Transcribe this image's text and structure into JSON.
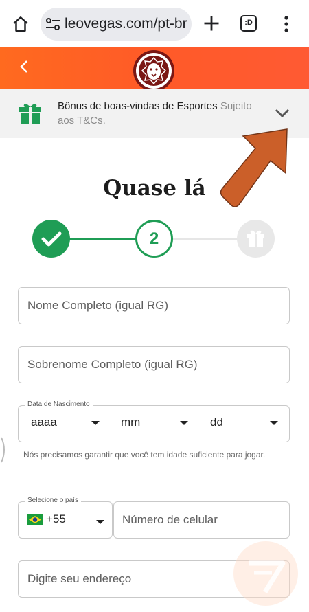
{
  "browser": {
    "url": "leovegas.com/pt-br",
    "tabs_label": ":D",
    "icons": {
      "home": "home-icon",
      "site_settings": "tune-icon",
      "new_tab": "plus-icon",
      "menu": "more-vert-icon"
    }
  },
  "header": {
    "back_icon": "chevron-left-icon",
    "logo": "leovegas-lion-logo",
    "bg_color": "#ff5a28"
  },
  "promo": {
    "icon": "gift-icon",
    "title": "Bônus de boas-vindas de Esportes",
    "terms": "Sujeito aos T&Cs.",
    "expand_icon": "chevron-down-icon"
  },
  "form": {
    "title": "Quase lá",
    "steps": [
      {
        "state": "done",
        "icon": "check-icon"
      },
      {
        "state": "current",
        "label": "2"
      },
      {
        "state": "pending",
        "icon": "gift-icon"
      }
    ],
    "name_placeholder": "Nome Completo (igual RG)",
    "surname_placeholder": "Sobrenome Completo (igual RG)",
    "dob": {
      "legend": "Data de Nascimento",
      "year": "aaaa",
      "month": "mm",
      "day": "dd"
    },
    "age_hint": "Nós precisamos garantir que você tem idade suficiente para jogar.",
    "country": {
      "legend": "Selecione o país",
      "flag": "brazil-flag-icon",
      "code": "+55"
    },
    "phone_placeholder": "Número de celular",
    "address_placeholder": "Digite seu endereço"
  },
  "colors": {
    "accent_green": "#1f9d55",
    "annotation_arrow": "#c9571e"
  }
}
